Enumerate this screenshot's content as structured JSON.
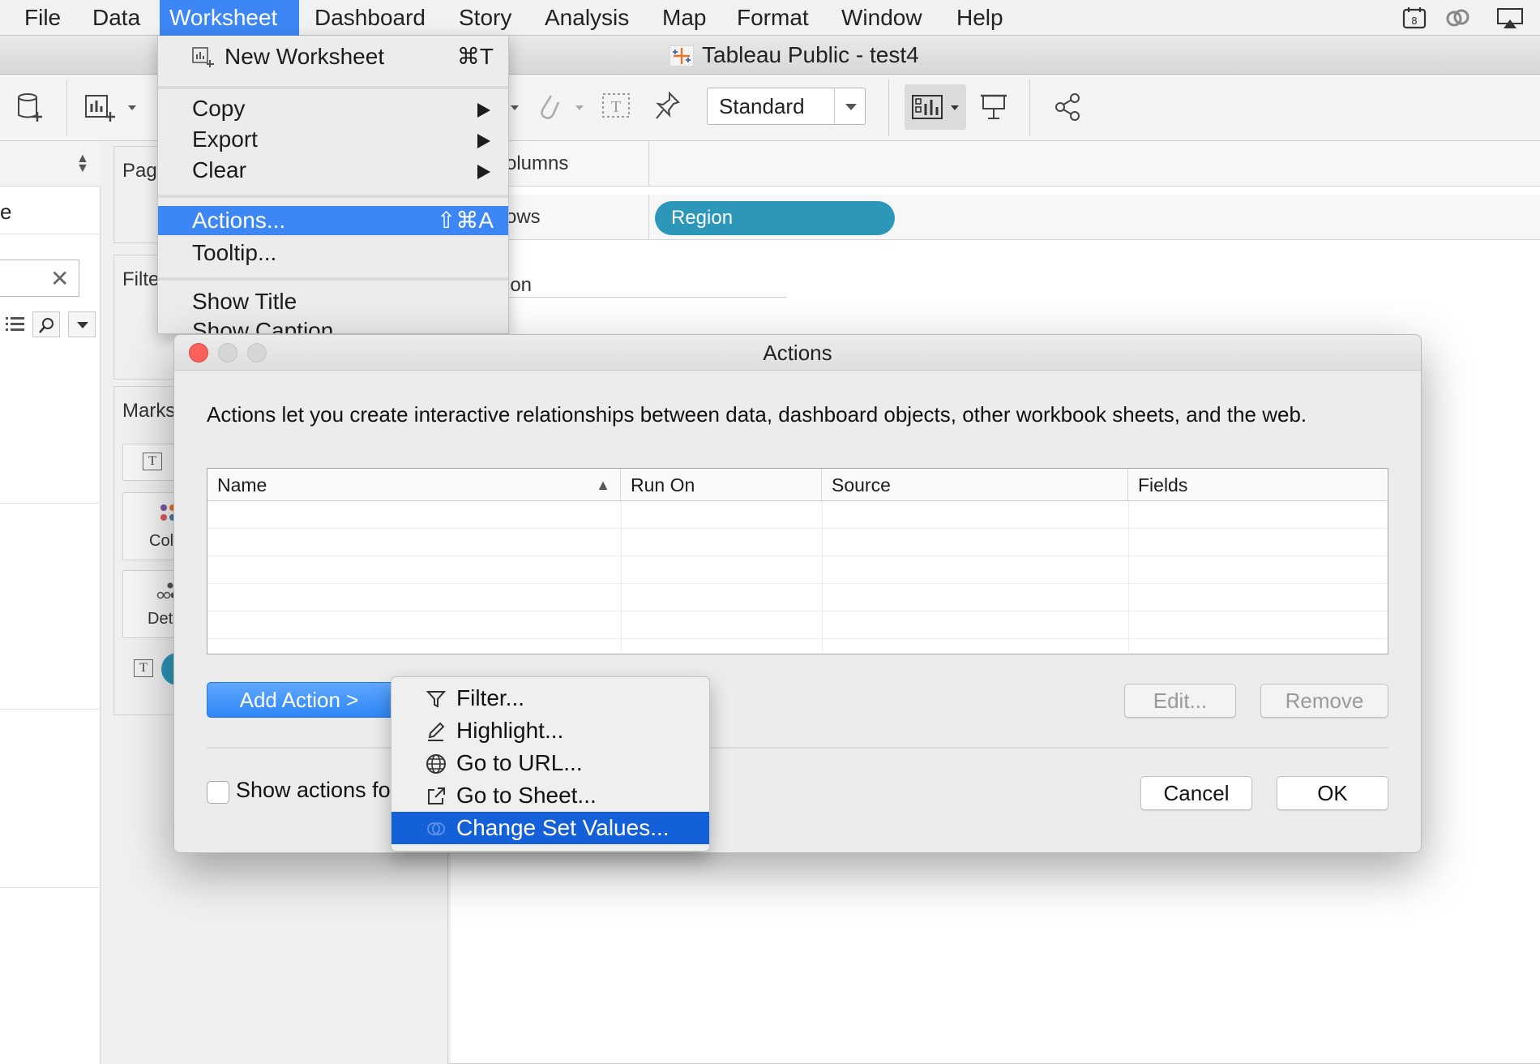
{
  "menubar": {
    "items": [
      "File",
      "Data",
      "Worksheet",
      "Dashboard",
      "Story",
      "Analysis",
      "Map",
      "Format",
      "Window",
      "Help"
    ],
    "active": "Worksheet"
  },
  "window": {
    "title": "Tableau Public - test4"
  },
  "toolbar": {
    "fit_value": "Standard"
  },
  "datapane": {
    "partial_label": "e",
    "search_clear": "✕"
  },
  "shelves": {
    "pages": "Pag",
    "filters": "Filte",
    "marks": "Marks",
    "columns": "olumns",
    "rows": "ows",
    "rows_pill": "Region",
    "view_header": "ion",
    "marks_buttons": {
      "color": "Col",
      "detail": "Det"
    }
  },
  "worksheet_menu": {
    "new_worksheet": {
      "label": "New Worksheet",
      "shortcut": "⌘T"
    },
    "copy": "Copy",
    "export": "Export",
    "clear": "Clear",
    "actions": {
      "label": "Actions...",
      "shortcut": "⇧⌘A"
    },
    "tooltip": "Tooltip...",
    "show_title": "Show Title",
    "show_caption": "Show Caption"
  },
  "actions_dialog": {
    "title": "Actions",
    "description": "Actions let you create interactive relationships between data, dashboard objects, other workbook sheets, and the web.",
    "columns": [
      "Name",
      "Run On",
      "Source",
      "Fields"
    ],
    "sort_indicator": "▲",
    "add_action_label": "Add Action >",
    "edit_label": "Edit...",
    "remove_label": "Remove",
    "show_actions_label": "Show actions for all sheets in this workbook",
    "cancel_label": "Cancel",
    "ok_label": "OK"
  },
  "add_action_menu": {
    "items": [
      "Filter...",
      "Highlight...",
      "Go to URL...",
      "Go to Sheet...",
      "Change Set Values..."
    ],
    "icons": [
      "filter-icon",
      "highlight-icon",
      "globe-icon",
      "external-link-icon",
      "set-icon"
    ],
    "highlighted": "Change Set Values..."
  }
}
